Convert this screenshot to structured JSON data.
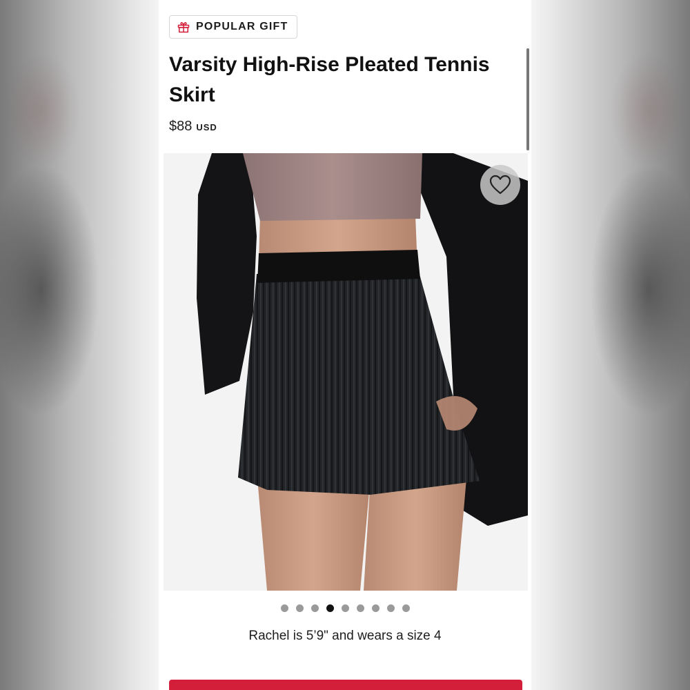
{
  "badge": {
    "label": "POPULAR GIFT",
    "icon": "gift-icon"
  },
  "product": {
    "title": "Varsity High-Rise Pleated Tennis Skirt",
    "price": "$88",
    "currency": "USD"
  },
  "gallery": {
    "image_count": 9,
    "active_index": 3,
    "model_note": "Rachel is 5’9\" and wears a size 4"
  },
  "colors": {
    "accent": "#d31f3a",
    "dot_inactive": "#9a9a9a",
    "dot_active": "#111111"
  },
  "icons": {
    "wishlist": "heart-icon"
  }
}
